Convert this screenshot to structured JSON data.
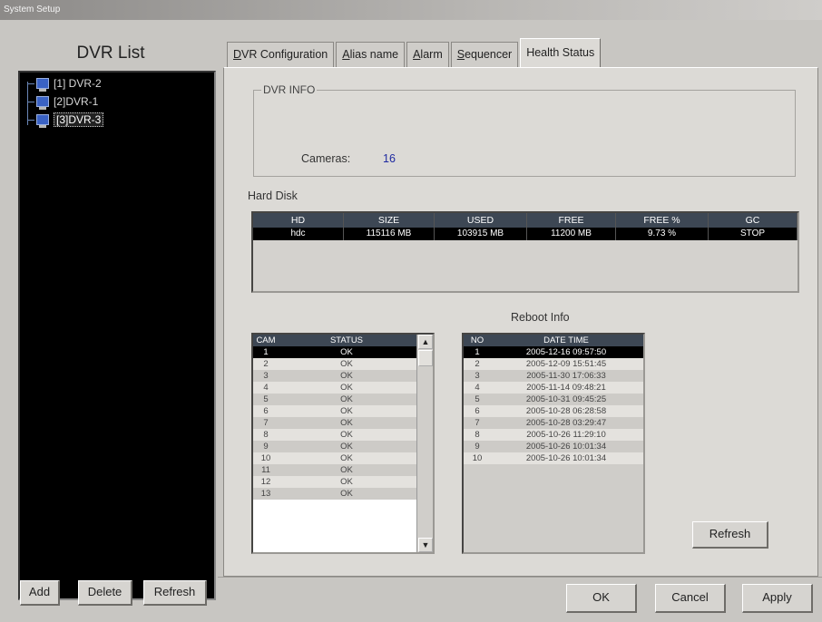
{
  "window": {
    "title": "System Setup"
  },
  "dvr_list": {
    "heading": "DVR List",
    "items": [
      {
        "label": "[1] DVR-2",
        "selected": false
      },
      {
        "label": "[2]DVR-1",
        "selected": false
      },
      {
        "label": "[3]DVR-3",
        "selected": true
      }
    ],
    "buttons": {
      "add": "Add",
      "delete": "Delete",
      "refresh": "Refresh"
    }
  },
  "tabs": [
    {
      "label": "DVR Configuration",
      "accel": "D",
      "rest": "VR Configuration",
      "active": false
    },
    {
      "label": "Alias name",
      "accel": "A",
      "rest": "lias name",
      "active": false
    },
    {
      "label": "Alarm",
      "accel": "A",
      "rest": "larm",
      "active": false
    },
    {
      "label": "Sequencer",
      "accel": "S",
      "rest": "equencer",
      "active": false
    },
    {
      "label": "Health Status",
      "accel": "",
      "rest": "Health Status",
      "active": true
    }
  ],
  "dvr_info": {
    "title": "DVR INFO",
    "cameras_label": "Cameras:",
    "cameras_value": "16"
  },
  "hard_disk": {
    "title": "Hard Disk",
    "columns": [
      "HD",
      "SIZE",
      "USED",
      "FREE",
      "FREE %",
      "GC"
    ],
    "rows": [
      [
        "hdc",
        "115116 MB",
        "103915 MB",
        "11200 MB",
        "9.73 %",
        "STOP"
      ]
    ]
  },
  "reboot_info": {
    "title": "Reboot Info",
    "columns": [
      "NO",
      "DATE TIME"
    ],
    "rows": [
      [
        "1",
        "2005-12-16 09:57:50"
      ],
      [
        "2",
        "2005-12-09 15:51:45"
      ],
      [
        "3",
        "2005-11-30 17:06:33"
      ],
      [
        "4",
        "2005-11-14 09:48:21"
      ],
      [
        "5",
        "2005-10-31 09:45:25"
      ],
      [
        "6",
        "2005-10-28 06:28:58"
      ],
      [
        "7",
        "2005-10-28 03:29:47"
      ],
      [
        "8",
        "2005-10-26 11:29:10"
      ],
      [
        "9",
        "2005-10-26 10:01:34"
      ],
      [
        "10",
        "2005-10-26 10:01:34"
      ]
    ]
  },
  "camera_status": {
    "columns": [
      "CAM",
      "STATUS"
    ],
    "rows": [
      [
        "1",
        "OK"
      ],
      [
        "2",
        "OK"
      ],
      [
        "3",
        "OK"
      ],
      [
        "4",
        "OK"
      ],
      [
        "5",
        "OK"
      ],
      [
        "6",
        "OK"
      ],
      [
        "7",
        "OK"
      ],
      [
        "8",
        "OK"
      ],
      [
        "9",
        "OK"
      ],
      [
        "10",
        "OK"
      ],
      [
        "11",
        "OK"
      ],
      [
        "12",
        "OK"
      ],
      [
        "13",
        "OK"
      ]
    ]
  },
  "health_refresh_label": "Refresh",
  "dialog_buttons": {
    "ok": "OK",
    "cancel": "Cancel",
    "apply": "Apply"
  }
}
